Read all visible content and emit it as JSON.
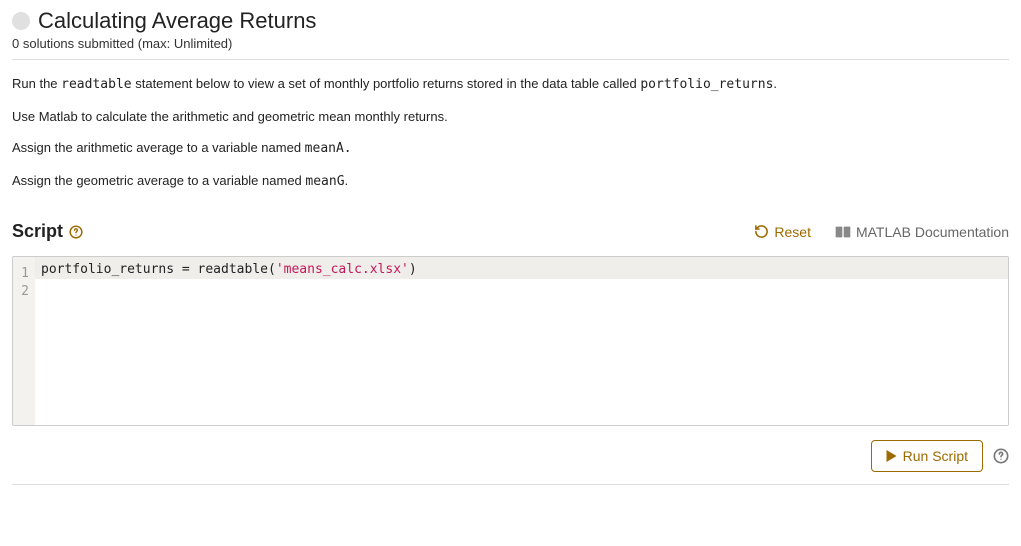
{
  "header": {
    "title": "Calculating Average Returns",
    "subtitle": "0 solutions submitted (max: Unlimited)"
  },
  "instructions": {
    "p1_a": "Run the ",
    "p1_code1": "readtable",
    "p1_b": " statement below to view a set of monthly portfolio returns stored in the data table called ",
    "p1_code2": "portfolio_returns",
    "p1_c": ".",
    "p2": "Use Matlab to calculate the arithmetic and geometric mean monthly returns.",
    "p3_a": "Assign the arithmetic average to a variable named ",
    "p3_code": "meanA.",
    "p4_a": "Assign the geometric average to a variable named ",
    "p4_code": "meanG",
    "p4_b": "."
  },
  "script": {
    "label": "Script",
    "reset": "Reset",
    "docs": "MATLAB Documentation",
    "run": "Run Script"
  },
  "editor": {
    "lines": [
      "1",
      "2"
    ],
    "code": {
      "l1_a": "portfolio_returns = readtable(",
      "l1_str": "'means_calc.xlsx'",
      "l1_b": ")"
    }
  }
}
